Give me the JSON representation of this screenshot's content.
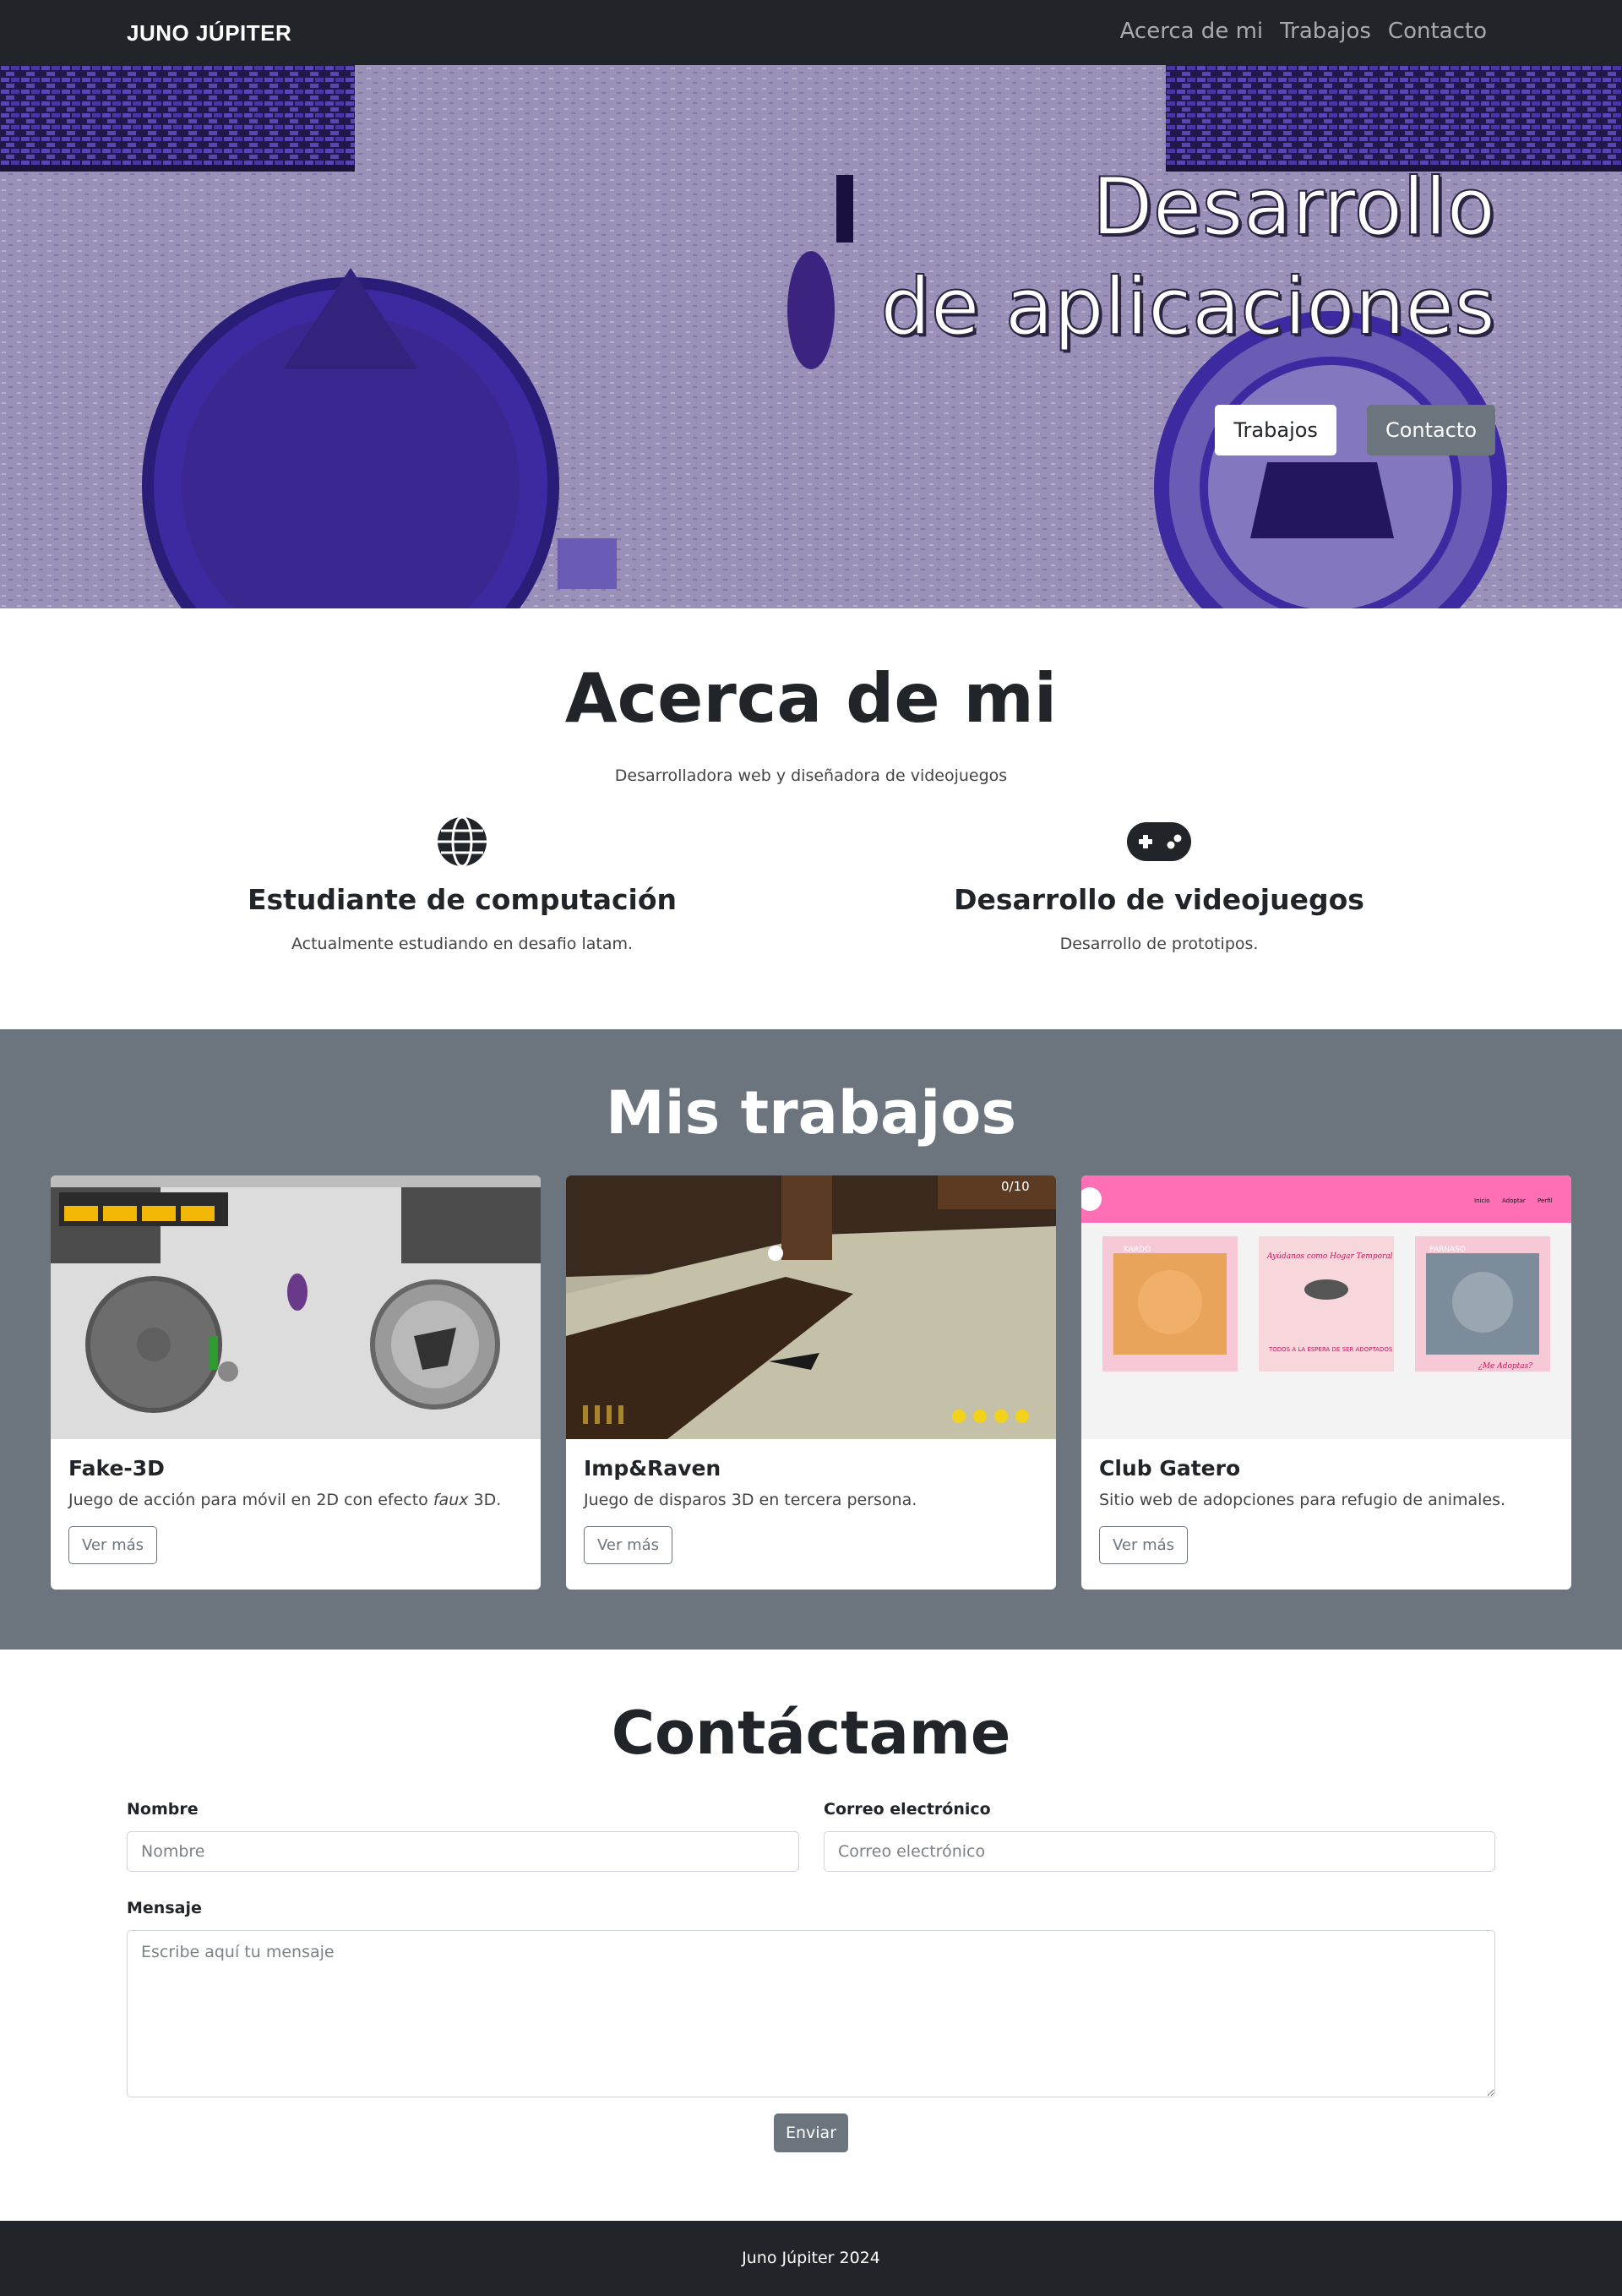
{
  "navbar": {
    "brand": "JUNO JÚPITER",
    "links": [
      "Acerca de mi",
      "Trabajos",
      "Contacto"
    ]
  },
  "hero": {
    "title_line1": "Desarrollo",
    "title_line2": "de aplicaciones",
    "btn_works": "Trabajos",
    "btn_contact": "Contacto"
  },
  "about": {
    "title": "Acerca de mi",
    "subtitle": "Desarrolladora web y diseñadora de videojuegos",
    "features": [
      {
        "icon": "globe-icon",
        "title": "Estudiante de computación",
        "text": "Actualmente estudiando en desafio latam."
      },
      {
        "icon": "gamepad-icon",
        "title": "Desarrollo de videojuegos",
        "text": "Desarrollo de prototipos."
      }
    ]
  },
  "works": {
    "title": "Mis trabajos",
    "cards": [
      {
        "title": "Fake-3D",
        "text_before": "Juego de acción para móvil en 2D con efecto ",
        "text_em": "faux",
        "text_after": " 3D.",
        "button": "Ver más"
      },
      {
        "title": "Imp&Raven",
        "text": "Juego de disparos 3D en tercera persona.",
        "button": "Ver más",
        "hud_counter": "0/10"
      },
      {
        "title": "Club Gatero",
        "text": "Sitio web de adopciones para refugio de animales.",
        "button": "Ver más",
        "thumb_nav": [
          "Inicio",
          "Adoptar",
          "Perfil"
        ],
        "thumb_cards": [
          "KARDO",
          "Ayúdanos como Hogar Temporal",
          "PARNASO"
        ],
        "thumb_notice": "TODOS A LA ESPERA DE SER ADOPTADOS",
        "thumb_adopt": "¿Me Adoptas?"
      }
    ]
  },
  "contact": {
    "title": "Contáctame",
    "name_label": "Nombre",
    "name_placeholder": "Nombre",
    "email_label": "Correo electrónico",
    "email_placeholder": "Correo electrónico",
    "message_label": "Mensaje",
    "message_placeholder": "Escribe aquí tu mensaje",
    "submit": "Enviar"
  },
  "footer": {
    "text": "Juno Júpiter 2024"
  },
  "colors": {
    "dark": "#212529",
    "gray": "#6c757d",
    "hero_purple": "#9a90b8",
    "hero_deep": "#3d2aa0",
    "club_pink": "#ff6fb5"
  }
}
